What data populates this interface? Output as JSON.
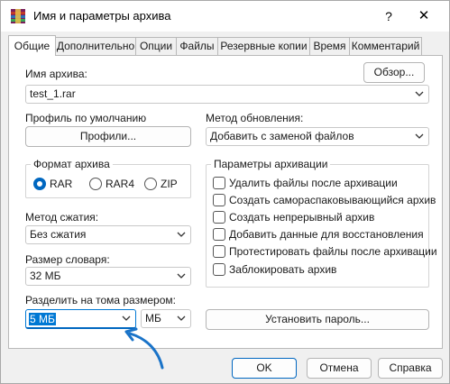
{
  "window": {
    "title": "Имя и параметры архива",
    "help_glyph": "?",
    "close_glyph": "✕"
  },
  "tabs": [
    {
      "label": "Общие",
      "active": true
    },
    {
      "label": "Дополнительно",
      "active": false
    },
    {
      "label": "Опции",
      "active": false
    },
    {
      "label": "Файлы",
      "active": false
    },
    {
      "label": "Резервные копии",
      "active": false
    },
    {
      "label": "Время",
      "active": false
    },
    {
      "label": "Комментарий",
      "active": false
    }
  ],
  "archive_name": {
    "label": "Имя архива:",
    "value": "test_1.rar",
    "browse_button": "Обзор..."
  },
  "profile": {
    "label": "Профиль по умолчанию",
    "button": "Профили..."
  },
  "update_method": {
    "label": "Метод обновления:",
    "value": "Добавить с заменой файлов"
  },
  "archive_format": {
    "title": "Формат архива",
    "options": [
      {
        "label": "RAR",
        "checked": true
      },
      {
        "label": "RAR4",
        "checked": false
      },
      {
        "label": "ZIP",
        "checked": false
      }
    ]
  },
  "compression": {
    "label": "Метод сжатия:",
    "value": "Без сжатия"
  },
  "dictionary": {
    "label": "Размер словаря:",
    "value": "32 МБ"
  },
  "split": {
    "label": "Разделить на тома размером:",
    "value": "5 МБ",
    "unit": "МБ"
  },
  "archive_options": {
    "title": "Параметры архивации",
    "items": [
      {
        "label": "Удалить файлы после архивации",
        "checked": false
      },
      {
        "label": "Создать самораспаковывающийся архив",
        "checked": false
      },
      {
        "label": "Создать непрерывный архив",
        "checked": false
      },
      {
        "label": "Добавить данные для восстановления",
        "checked": false
      },
      {
        "label": "Протестировать файлы после архивации",
        "checked": false
      },
      {
        "label": "Заблокировать архив",
        "checked": false
      }
    ]
  },
  "set_password_button": "Установить пароль...",
  "footer": {
    "ok": "OK",
    "cancel": "Отмена",
    "help": "Справка"
  },
  "colors": {
    "accent": "#0067c0",
    "selection": "#0078d4",
    "annotation_arrow": "#1a73c8"
  }
}
